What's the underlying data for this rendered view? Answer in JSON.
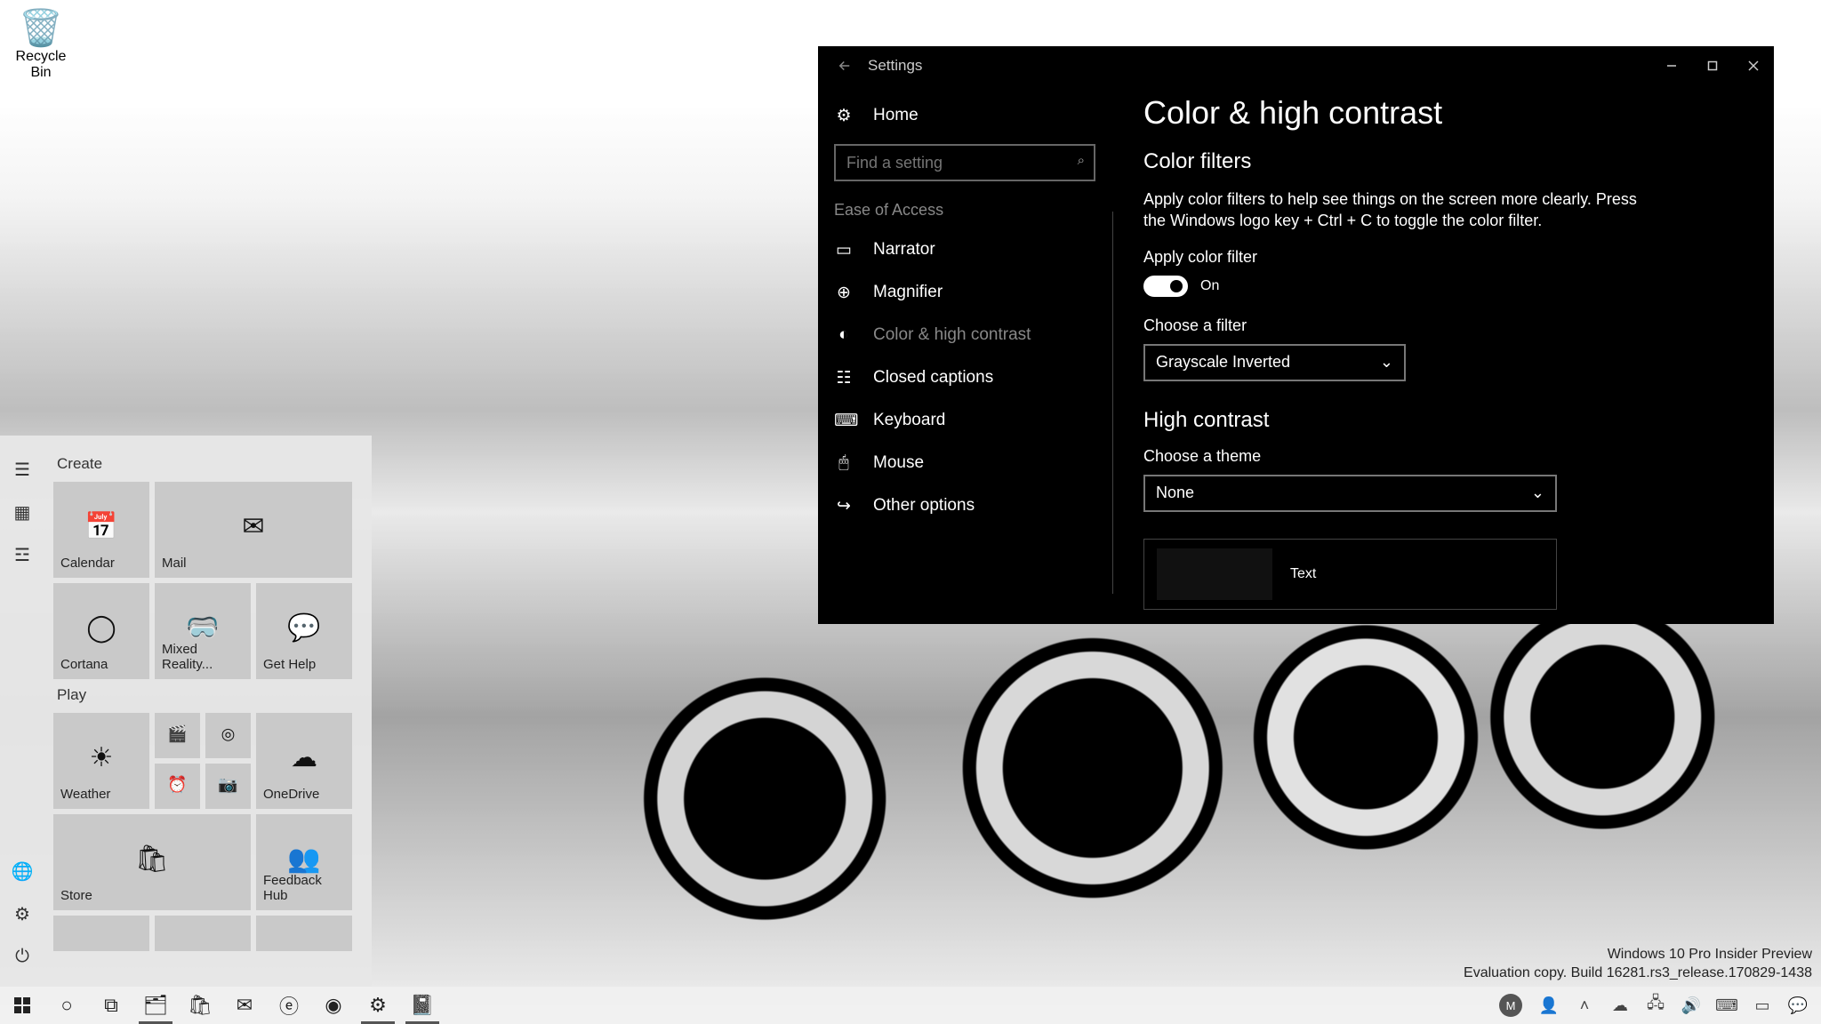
{
  "desktop": {
    "recycle_bin": "Recycle Bin"
  },
  "settings": {
    "title": "Settings",
    "home": "Home",
    "search_placeholder": "Find a setting",
    "category": "Ease of Access",
    "nav": {
      "narrator": "Narrator",
      "magnifier": "Magnifier",
      "color_high_contrast": "Color & high contrast",
      "closed_captions": "Closed captions",
      "keyboard": "Keyboard",
      "mouse": "Mouse",
      "other": "Other options"
    },
    "page": {
      "heading": "Color & high contrast",
      "section_filters": "Color filters",
      "filters_desc": "Apply color filters to help see things on the screen more clearly. Press the Windows logo key + Ctrl + C to toggle the color filter.",
      "apply_label": "Apply color filter",
      "toggle_state": "On",
      "choose_filter": "Choose a filter",
      "filter_value": "Grayscale Inverted",
      "section_hc": "High contrast",
      "choose_theme": "Choose a theme",
      "theme_value": "None",
      "preview_text": "Text"
    }
  },
  "start": {
    "group_create": "Create",
    "group_play": "Play",
    "tiles": {
      "calendar": "Calendar",
      "mail": "Mail",
      "cortana": "Cortana",
      "mixed_reality": "Mixed Reality...",
      "get_help": "Get Help",
      "weather": "Weather",
      "onedrive": "OneDrive",
      "store": "Store",
      "feedback": "Feedback Hub"
    }
  },
  "watermark": {
    "line1": "Windows 10 Pro Insider Preview",
    "line2": "Evaluation copy. Build 16281.rs3_release.170829-1438"
  },
  "tray": {
    "avatar_initial": "M"
  }
}
